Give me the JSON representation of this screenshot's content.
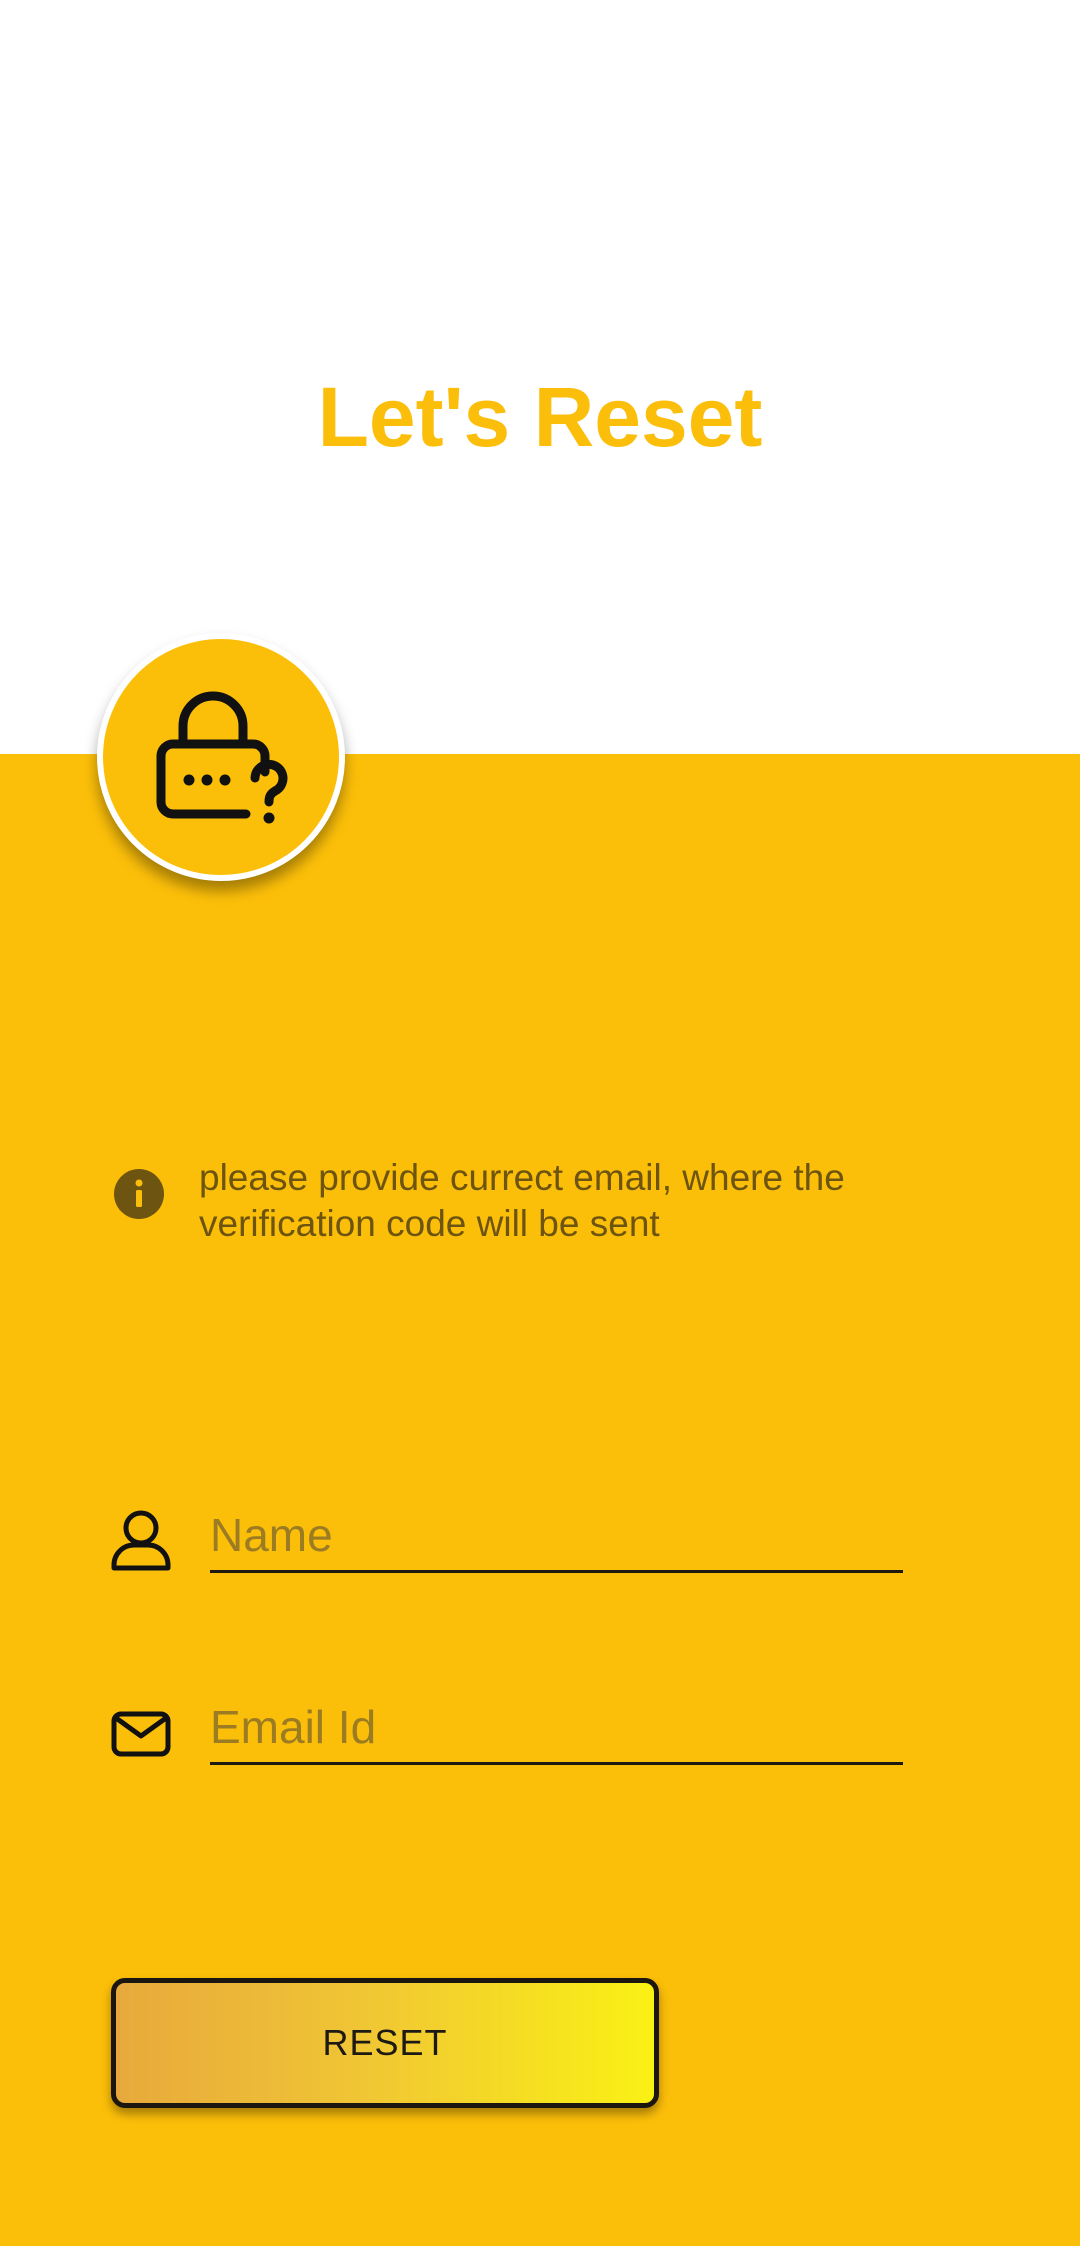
{
  "header": {
    "title": "Let's Reset",
    "title_color": "#FBBE0A"
  },
  "hero_icon": {
    "icon": "lock-question-icon",
    "background": "#FCBF09"
  },
  "info": {
    "icon": "info-icon",
    "text": "please provide currect email, where the verification code will be sent"
  },
  "form": {
    "name": {
      "icon": "user-icon",
      "placeholder": "Name",
      "value": ""
    },
    "email": {
      "icon": "mail-icon",
      "placeholder": "Email Id",
      "value": ""
    }
  },
  "actions": {
    "reset_label": "RESET"
  },
  "theme": {
    "accent": "#FCBF09",
    "background_top": "#FFFFFF"
  }
}
